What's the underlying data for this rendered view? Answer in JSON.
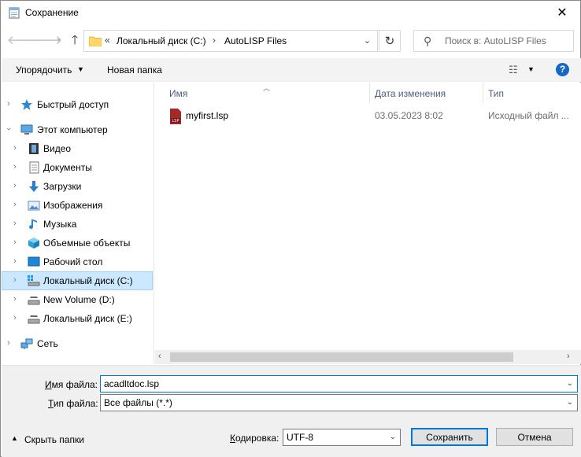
{
  "window": {
    "title": "Сохранение",
    "close_glyph": "✕"
  },
  "address": {
    "overflow": "«",
    "segments": [
      "Локальный диск (C:)",
      "AutoLISP Files"
    ],
    "separator": "›"
  },
  "search": {
    "placeholder": "Поиск в: AutoLISP Files"
  },
  "toolbar": {
    "organize": "Упорядочить",
    "new_folder": "Новая папка",
    "help": "?"
  },
  "nav": {
    "items": [
      {
        "label": "Быстрый доступ",
        "icon": "star-icon"
      },
      {
        "label": "Этот компьютер",
        "icon": "computer-icon"
      },
      {
        "label": "Видео",
        "icon": "video-icon"
      },
      {
        "label": "Документы",
        "icon": "documents-icon"
      },
      {
        "label": "Загрузки",
        "icon": "download-icon"
      },
      {
        "label": "Изображения",
        "icon": "pictures-icon"
      },
      {
        "label": "Музыка",
        "icon": "music-icon"
      },
      {
        "label": "Объемные объекты",
        "icon": "3d-objects-icon"
      },
      {
        "label": "Рабочий стол",
        "icon": "desktop-icon"
      },
      {
        "label": "Локальный диск (C:)",
        "icon": "drive-icon",
        "selected": true
      },
      {
        "label": "New Volume (D:)",
        "icon": "drive-icon"
      },
      {
        "label": "Локальный диск (E:)",
        "icon": "drive-icon"
      },
      {
        "label": "Сеть",
        "icon": "network-icon"
      }
    ]
  },
  "columns": {
    "name": "Имя",
    "date": "Дата изменения",
    "type": "Тип"
  },
  "files": [
    {
      "name": "myfirst.lsp",
      "date": "03.05.2023 8:02",
      "type": "Исходный файл ...",
      "icon": "lsp-file-icon",
      "icon_text": "LSP"
    }
  ],
  "form": {
    "filename_label_u": "И",
    "filename_label_rest": "мя файла:",
    "filename_value": "acadltdoc.lsp",
    "filetype_label_u": "Т",
    "filetype_label_rest": "ип файла:",
    "filetype_value": "Все файлы  (*.*)",
    "hide_folders": "Скрыть папки",
    "encoding_label_u": "К",
    "encoding_label_rest": "одировка:",
    "encoding_value": "UTF-8",
    "save_label": "Сохранить",
    "cancel_label": "Отмена"
  },
  "colors": {
    "accent": "#0078d7",
    "selection": "#cce8ff",
    "header_text": "#4c607a",
    "help": "#1668c2"
  }
}
